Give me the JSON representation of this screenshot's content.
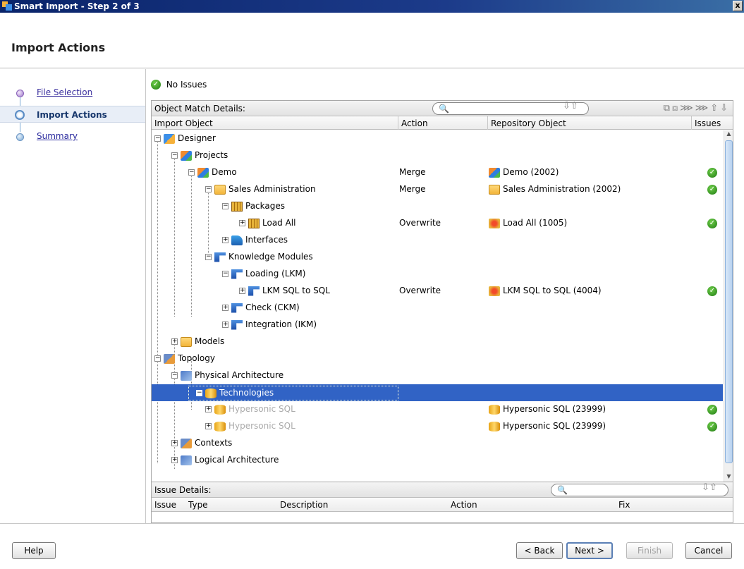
{
  "window": {
    "title": "Smart Import - Step 2 of 3",
    "close_glyph": "x"
  },
  "header": {
    "title": "Import Actions"
  },
  "steps": [
    {
      "label": "File Selection"
    },
    {
      "label": "Import Actions"
    },
    {
      "label": "Summary"
    }
  ],
  "status": {
    "text": "No Issues"
  },
  "match_panel": {
    "title": "Object Match Details:",
    "columns": [
      "Import Object",
      "Action",
      "Repository Object",
      "Issues"
    ]
  },
  "tree": [
    {
      "name": "Designer",
      "action": "",
      "repo": "",
      "issue": false
    },
    {
      "name": "Projects",
      "action": "",
      "repo": "",
      "issue": false
    },
    {
      "name": "Demo",
      "action": "Merge",
      "repo": "Demo (2002)",
      "issue": true
    },
    {
      "name": "Sales Administration",
      "action": "Merge",
      "repo": "Sales Administration (2002)",
      "issue": true
    },
    {
      "name": "Packages",
      "action": "",
      "repo": "",
      "issue": false
    },
    {
      "name": "Load All",
      "action": "Overwrite",
      "repo": "Load All (1005)",
      "issue": true
    },
    {
      "name": "Interfaces",
      "action": "",
      "repo": "",
      "issue": false
    },
    {
      "name": "Knowledge Modules",
      "action": "",
      "repo": "",
      "issue": false
    },
    {
      "name": "Loading (LKM)",
      "action": "",
      "repo": "",
      "issue": false
    },
    {
      "name": "LKM SQL to SQL",
      "action": "Overwrite",
      "repo": "LKM SQL to SQL (4004)",
      "issue": true
    },
    {
      "name": "Check (CKM)",
      "action": "",
      "repo": "",
      "issue": false
    },
    {
      "name": "Integration (IKM)",
      "action": "",
      "repo": "",
      "issue": false
    },
    {
      "name": "Models",
      "action": "",
      "repo": "",
      "issue": false
    },
    {
      "name": "Topology",
      "action": "",
      "repo": "",
      "issue": false
    },
    {
      "name": "Physical Architecture",
      "action": "",
      "repo": "",
      "issue": false
    },
    {
      "name": "Technologies",
      "action": "",
      "repo": "",
      "issue": false
    },
    {
      "name": "Hypersonic SQL",
      "action": "",
      "repo": "Hypersonic SQL (23999)",
      "issue": true
    },
    {
      "name": "Hypersonic SQL",
      "action": "",
      "repo": "Hypersonic SQL (23999)",
      "issue": true
    },
    {
      "name": "Contexts",
      "action": "",
      "repo": "",
      "issue": false
    },
    {
      "name": "Logical Architecture",
      "action": "",
      "repo": "",
      "issue": false
    }
  ],
  "issue_panel": {
    "title": "Issue Details:",
    "columns": [
      "Issue",
      "Type",
      "Description",
      "Action",
      "Fix"
    ]
  },
  "buttons": {
    "help": "Help",
    "back": "< Back",
    "next": "Next >",
    "finish": "Finish",
    "cancel": "Cancel"
  },
  "colors": {
    "selection": "#3163c5",
    "titlebar": "#0a246a"
  }
}
